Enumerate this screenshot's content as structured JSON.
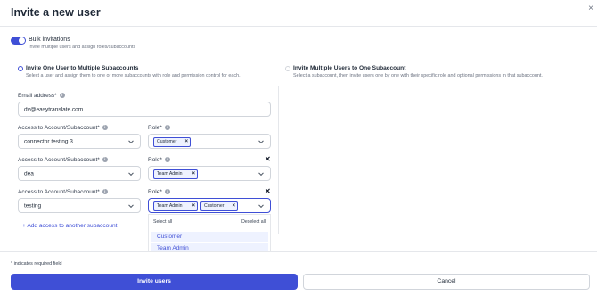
{
  "modal": {
    "title": "Invite a new user",
    "close_glyph": "×"
  },
  "bulk": {
    "title": "Bulk invitations",
    "subtitle": "Invite multiple users and assign roles/subaccounts",
    "enabled": true
  },
  "options": {
    "one_to_many": {
      "title": "Invite One User to Multiple Subaccounts",
      "description": "Select a user and assign them to one or more subaccounts with role and permission control for each.",
      "selected": true
    },
    "many_to_one": {
      "title": "Invite Multiple Users to One Subaccount",
      "description": "Select a subaccount, then invite users one by one with their specific role and optional permissions in that subaccount.",
      "selected": false
    }
  },
  "email": {
    "label": "Email address*",
    "value": "dv@easytranslate.com"
  },
  "access_rows": [
    {
      "access_label": "Access to Account/Subaccount*",
      "account": "connector testing 3",
      "role_label": "Role*",
      "roles": [
        "Customer"
      ]
    },
    {
      "access_label": "Access to Account/Subaccount*",
      "account": "dea",
      "role_label": "Role*",
      "roles": [
        "Team Admin"
      ]
    },
    {
      "access_label": "Access to Account/Subaccount*",
      "account": "testing",
      "role_label": "Role*",
      "roles": [
        "Team Admin",
        "Customer"
      ]
    }
  ],
  "add_access": "+ Add access to another subaccount",
  "role_dropdown": {
    "select_all": "Select all",
    "deselect_all": "Deselect all",
    "options": [
      "Customer",
      "Team Admin"
    ]
  },
  "footer": {
    "required_note": "* indicates required field",
    "invite_button": "Invite users",
    "cancel_button": "Cancel"
  },
  "colors": {
    "accent": "#3f4fd6",
    "border": "#d1d5db",
    "chip_bg": "#eef2ff"
  },
  "icons": {
    "info": "info-icon",
    "close": "close-icon",
    "chevron": "chevron-down-icon",
    "remove": "remove-row-icon"
  }
}
